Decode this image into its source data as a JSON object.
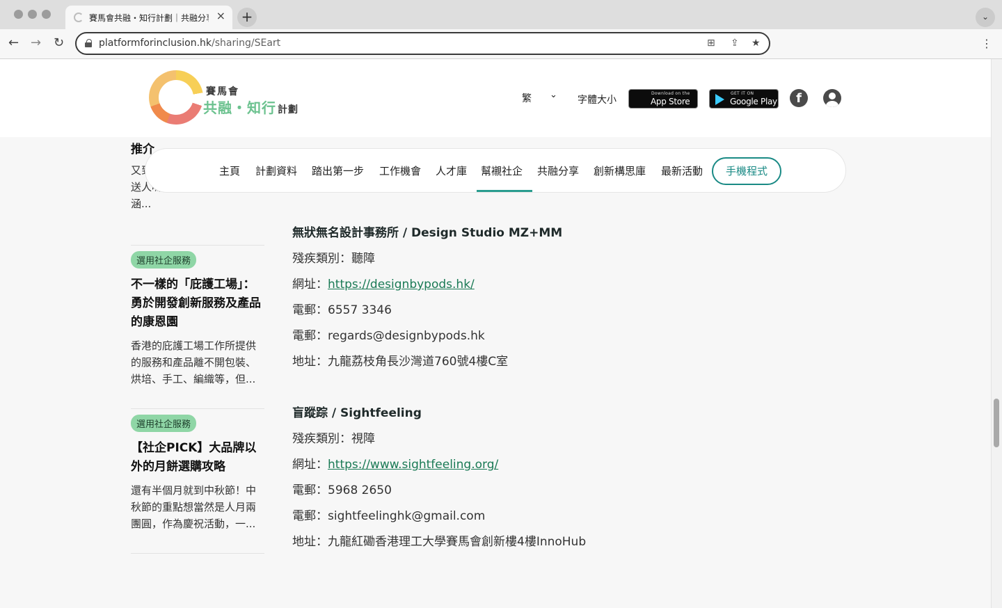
{
  "browser": {
    "tab_title": "賽馬會共融・知行計劃｜共融分享",
    "url_host": "platformforinclusion.hk",
    "url_path": "/sharing/SEart"
  },
  "header": {
    "logo_line1": "賽馬會",
    "logo_line2": "共融・知行",
    "logo_line2_suffix": "計劃",
    "lang": "繁",
    "font_size": "字體大小",
    "appstore_small": "Download on the",
    "appstore_big": "App Store",
    "googleplay_small": "GET IT ON",
    "googleplay_big": "Google Play"
  },
  "nav": {
    "items": [
      "主頁",
      "計劃資料",
      "踏出第一步",
      "工作機會",
      "人才庫",
      "幫襯社企",
      "共融分享",
      "創新構思庫",
      "最新活動"
    ],
    "active_index": 5,
    "app_button": "手機程式",
    "accent_color": "#1a8a85"
  },
  "sidebar": {
    "cards": [
      {
        "title": "【社企PICK】聖誕禮品推介",
        "desc": "又到...煩惱買甚麼聖誕禮物送人嗎？想買份精美且有內涵..."
      },
      {
        "tag": "選用社企服務",
        "title": "不一樣的「庇護工場」：勇於開發創新服務及產品的康恩園",
        "desc": "香港的庇護工場工作所提供的服務和產品離不開包裝、烘培、手工、編織等，但..."
      },
      {
        "tag": "選用社企服務",
        "title": "【社企PICK】大品牌以外的月餅選購攻略",
        "desc": "還有半個月就到中秋節！中秋節的重點想當然是人月兩團圓，作為慶祝活動，一..."
      }
    ]
  },
  "entries": [
    {
      "title": "無狀無名設計事務所 / Design Studio MZ+MM",
      "disability_label": "殘疾類別：",
      "disability": "聽障",
      "website_label": "網址：",
      "website": "https://designbypods.hk/",
      "phone_label": "電郵：",
      "phone": "6557 3346",
      "email_label": "電郵：",
      "email": "regards@designbypods.hk",
      "address_label": "地址：",
      "address": "九龍荔枝角長沙灣道760號4樓C室"
    },
    {
      "title": "盲蹤踪 / Sightfeeling",
      "disability_label": "殘疾類別：",
      "disability": "視障",
      "website_label": "網址：",
      "website": "https://www.sightfeeling.org/",
      "phone_label": "電郵：",
      "phone": "5968 2650",
      "email_label": "電郵：",
      "email": "sightfeelinghk@gmail.com",
      "address_label": "地址：",
      "address": "九龍紅磡香港理工大學賽馬會創新樓4樓InnoHub"
    }
  ]
}
